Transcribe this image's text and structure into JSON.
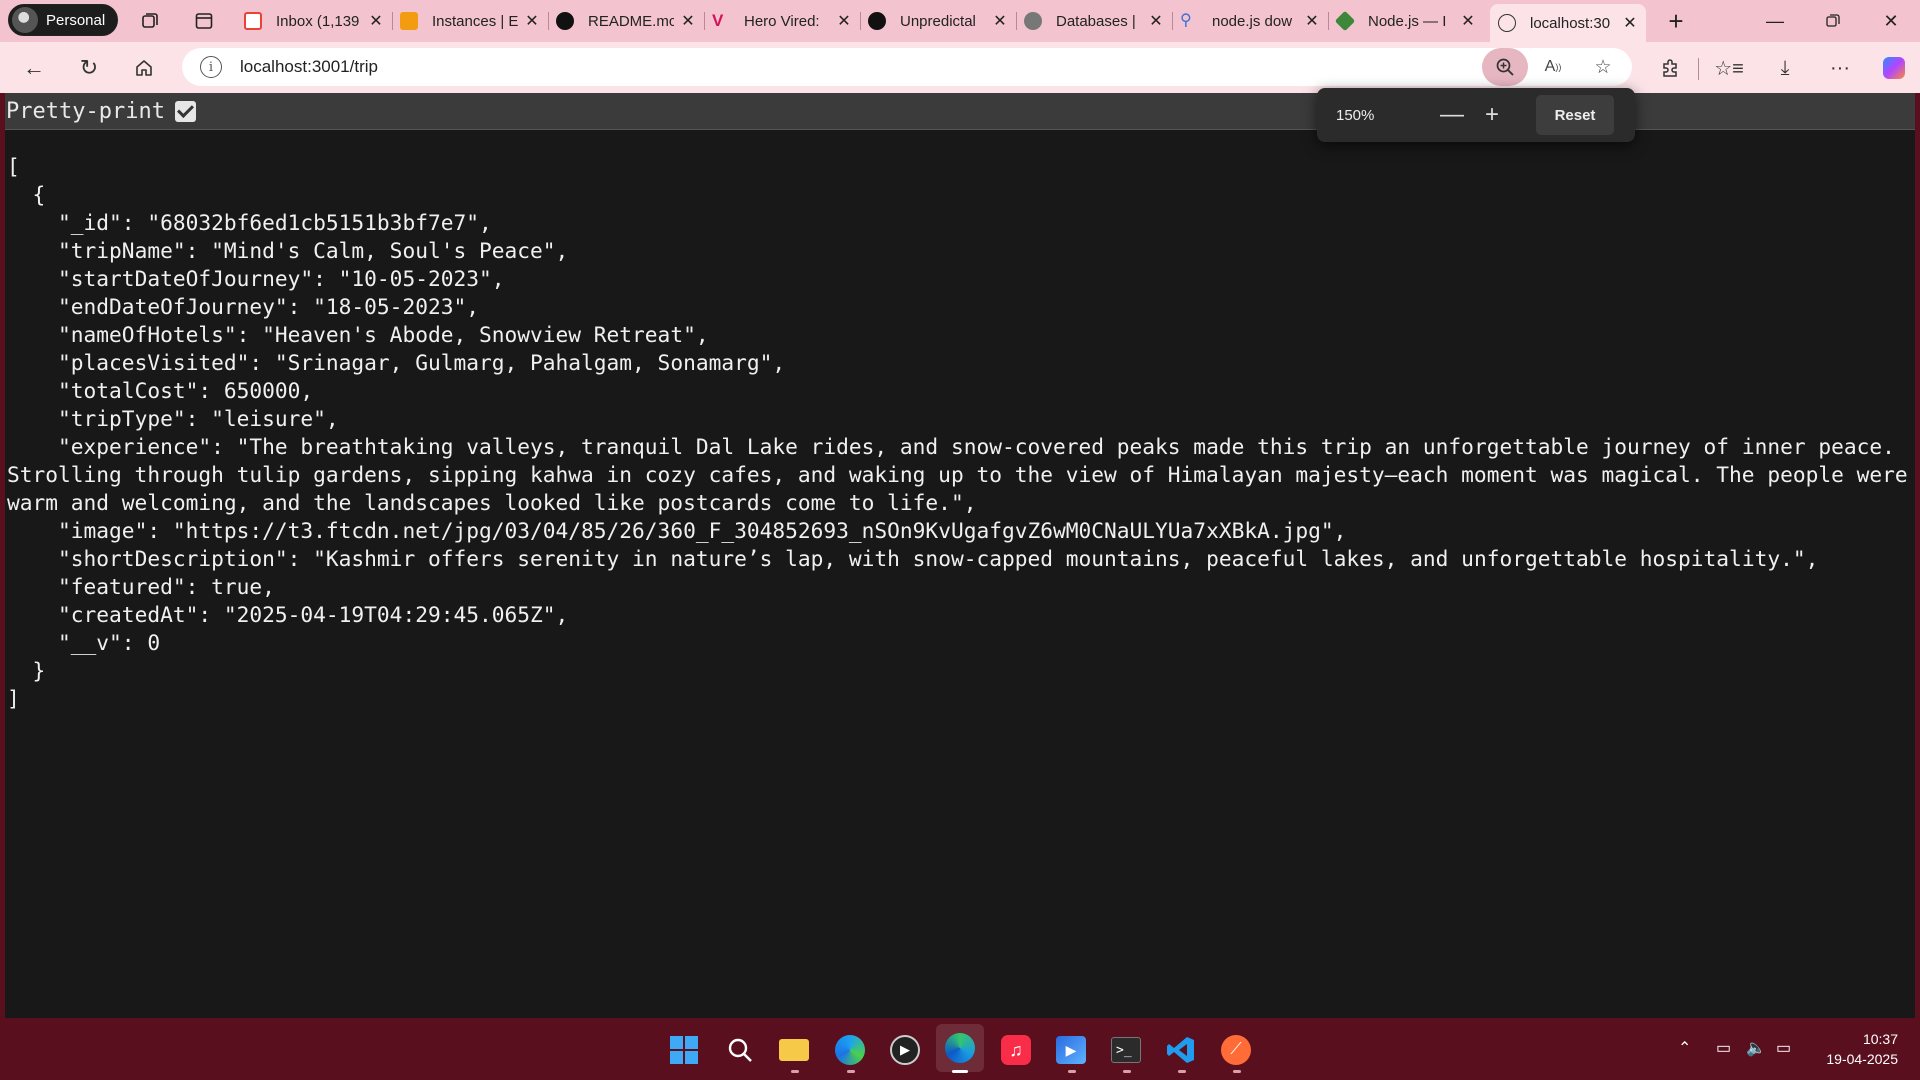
{
  "browser": {
    "profile_label": "Personal",
    "tabs": [
      {
        "title": "Inbox (1,139",
        "icon": "gmail-icon",
        "color": "#ea4335"
      },
      {
        "title": "Instances | E",
        "icon": "aws-icon",
        "color": "#f39c12"
      },
      {
        "title": "README.mc",
        "icon": "github-icon",
        "color": "#111111"
      },
      {
        "title": "Hero Vired:",
        "icon": "herovired-icon",
        "color": "#d4145a"
      },
      {
        "title": "Unpredictal",
        "icon": "github-icon",
        "color": "#111111"
      },
      {
        "title": "Databases |",
        "icon": "mongodb-icon",
        "color": "#6b6b6b"
      },
      {
        "title": "node.js dow",
        "icon": "search-icon",
        "color": "#3b6fd8"
      },
      {
        "title": "Node.js — I",
        "icon": "nodejs-icon",
        "color": "#3c873a"
      },
      {
        "title": "localhost:30",
        "icon": "globe-icon",
        "color": "#333333"
      }
    ],
    "active_tab_index": 8,
    "url": "localhost:3001/trip",
    "zoom": {
      "percent": "150%",
      "reset_label": "Reset"
    }
  },
  "page": {
    "pretty_print_label": "Pretty-print",
    "pretty_print_checked": true,
    "json_text": "[\n  {\n    \"_id\": \"68032bf6ed1cb5151b3bf7e7\",\n    \"tripName\": \"Mind's Calm, Soul's Peace\",\n    \"startDateOfJourney\": \"10-05-2023\",\n    \"endDateOfJourney\": \"18-05-2023\",\n    \"nameOfHotels\": \"Heaven's Abode, Snowview Retreat\",\n    \"placesVisited\": \"Srinagar, Gulmarg, Pahalgam, Sonamarg\",\n    \"totalCost\": 650000,\n    \"tripType\": \"leisure\",\n    \"experience\": \"The breathtaking valleys, tranquil Dal Lake rides, and snow-covered peaks made this trip an unforgettable journey of inner peace. Strolling through tulip gardens, sipping kahwa in cozy cafes, and waking up to the view of Himalayan majesty—each moment was magical. The people were warm and welcoming, and the landscapes looked like postcards come to life.\",\n    \"image\": \"https://t3.ftcdn.net/jpg/03/04/85/26/360_F_304852693_nSOn9KvUgafgvZ6wM0CNaULYUa7xXBkA.jpg\",\n    \"shortDescription\": \"Kashmir offers serenity in nature’s lap, with snow-capped mountains, peaceful lakes, and unforgettable hospitality.\",\n    \"featured\": true,\n    \"createdAt\": \"2025-04-19T04:29:45.065Z\",\n    \"__v\": 0\n  }\n]"
  },
  "taskbar": {
    "apps": [
      "windows-start-icon",
      "search-icon",
      "file-explorer-icon",
      "edge-dev-icon",
      "media-player-icon",
      "edge-icon",
      "music-icon",
      "clipchamp-icon",
      "terminal-icon",
      "vscode-icon",
      "postman-icon"
    ],
    "time": "10:37",
    "date": "19-04-2025"
  }
}
